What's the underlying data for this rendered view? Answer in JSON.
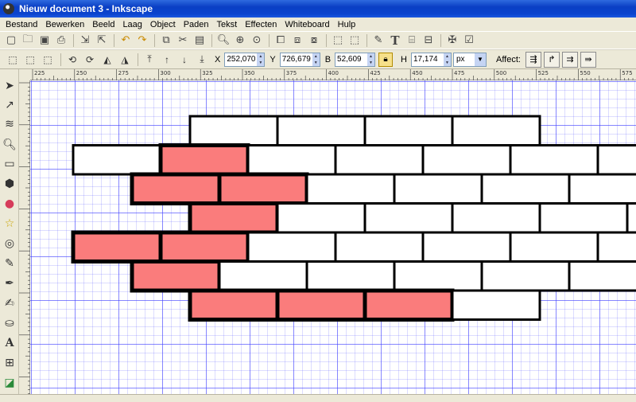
{
  "window": {
    "title": "Nieuw document 3 - Inkscape"
  },
  "menu": [
    "Bestand",
    "Bewerken",
    "Beeld",
    "Laag",
    "Object",
    "Paden",
    "Tekst",
    "Effecten",
    "Whiteboard",
    "Hulp"
  ],
  "toolbar": {
    "x_label": "X",
    "x_value": "252,070",
    "y_label": "Y",
    "y_value": "726,679",
    "w_label": "B",
    "w_value": "52,609",
    "h_label": "H",
    "h_value": "17,174",
    "unit": "px",
    "affect_label": "Affect:"
  },
  "ruler_labels": [
    "225",
    "250",
    "275",
    "300",
    "325",
    "350",
    "375",
    "400",
    "425",
    "450",
    "475",
    "500",
    "525",
    "550",
    "575"
  ],
  "colors": {
    "brick_fill_selected": "#fa7c7c",
    "brick_fill": "#ffffff",
    "brick_stroke": "#000000"
  },
  "bricks": {
    "rows": [
      {
        "count": 4,
        "selected": []
      },
      {
        "count": 7,
        "selected": [
          1
        ]
      },
      {
        "count": 6,
        "selected": [
          0,
          1
        ]
      },
      {
        "count": 6,
        "selected": [
          0
        ]
      },
      {
        "count": 7,
        "selected": [
          0,
          1
        ]
      },
      {
        "count": 6,
        "selected": [
          0
        ]
      },
      {
        "count": 4,
        "selected": [
          0,
          1,
          2
        ]
      }
    ]
  }
}
